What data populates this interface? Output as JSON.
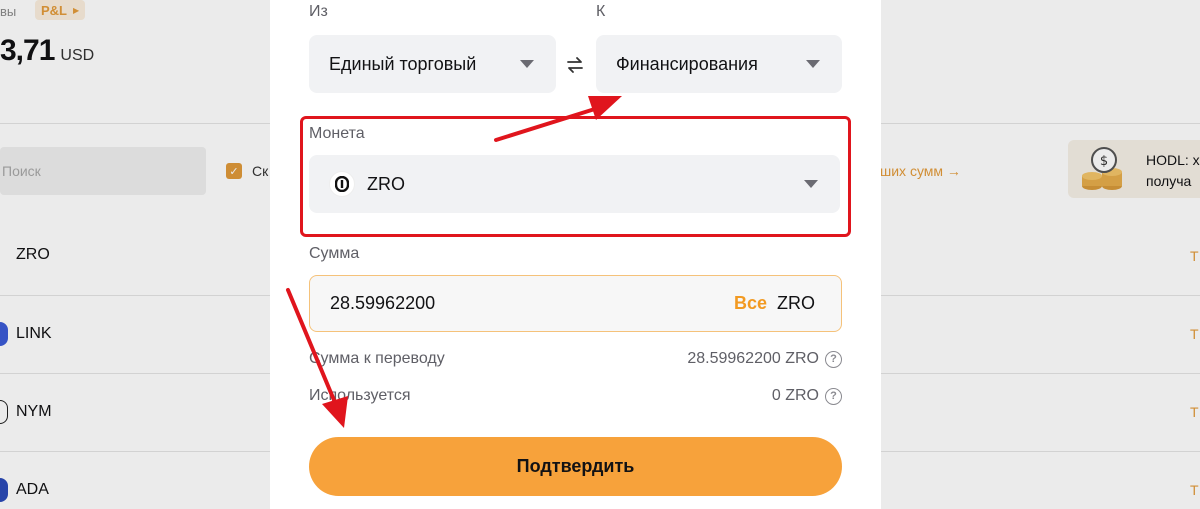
{
  "background": {
    "top_word": "вы",
    "pnl_label": "P&L",
    "balance_amount": "3,71",
    "balance_currency": "USD",
    "search_placeholder": "Поиск",
    "checkbox_label": "Ск",
    "link_text": "ших сумм →",
    "hodl_line1": "HODL: х",
    "hodl_line2": "получа",
    "coins": [
      "ZRO",
      "LINK",
      "NYM",
      "ADA"
    ],
    "row_end_char": "Т"
  },
  "modal": {
    "from_label": "Из",
    "to_label": "К",
    "from_value": "Единый торговый",
    "to_value": "Финансирования",
    "coin_label": "Монета",
    "coin_value": "ZRO",
    "amount_label": "Сумма",
    "amount_value": "28.59962200",
    "all_button": "Все",
    "amount_unit": "ZRO",
    "transfer_label": "Сумма к переводу",
    "transfer_value": "28.59962200 ZRO",
    "used_label": "Используется",
    "used_value": "0 ZRO",
    "confirm_button": "Подтвердить"
  },
  "colors": {
    "accent": "#f7a23b",
    "annotation": "#e0151d"
  }
}
